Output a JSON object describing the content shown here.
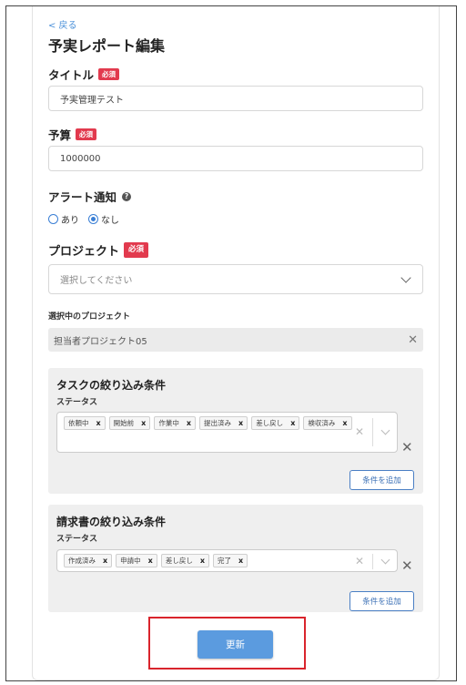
{
  "nav": {
    "back_label": "< 戻る"
  },
  "page_title": "予実レポート編集",
  "required_label": "必須",
  "title_field": {
    "label": "タイトル",
    "value": "予実管理テスト"
  },
  "budget_field": {
    "label": "予算",
    "value": "1000000"
  },
  "alert": {
    "label": "アラート通知",
    "help_icon": "question-circle-icon",
    "options": [
      {
        "label": "あり",
        "selected": false
      },
      {
        "label": "なし",
        "selected": true
      }
    ]
  },
  "project": {
    "label": "プロジェクト",
    "placeholder": "選択してください",
    "selected_label": "選択中のプロジェクト",
    "selected_value": "担当者プロジェクト05"
  },
  "task_filter": {
    "title": "タスクの絞り込み条件",
    "status_label": "ステータス",
    "chips": [
      "依頼中",
      "開始前",
      "作業中",
      "提出済み",
      "差し戻し",
      "検収済み"
    ],
    "add_button": "条件を追加"
  },
  "invoice_filter": {
    "title": "請求書の絞り込み条件",
    "status_label": "ステータス",
    "chips": [
      "作成済み",
      "申請中",
      "差し戻し",
      "完了"
    ],
    "add_button": "条件を追加"
  },
  "update_button": "更新",
  "colors": {
    "accent": "#5b9bdf",
    "required": "#e23a4e",
    "highlight": "#d9242c"
  }
}
